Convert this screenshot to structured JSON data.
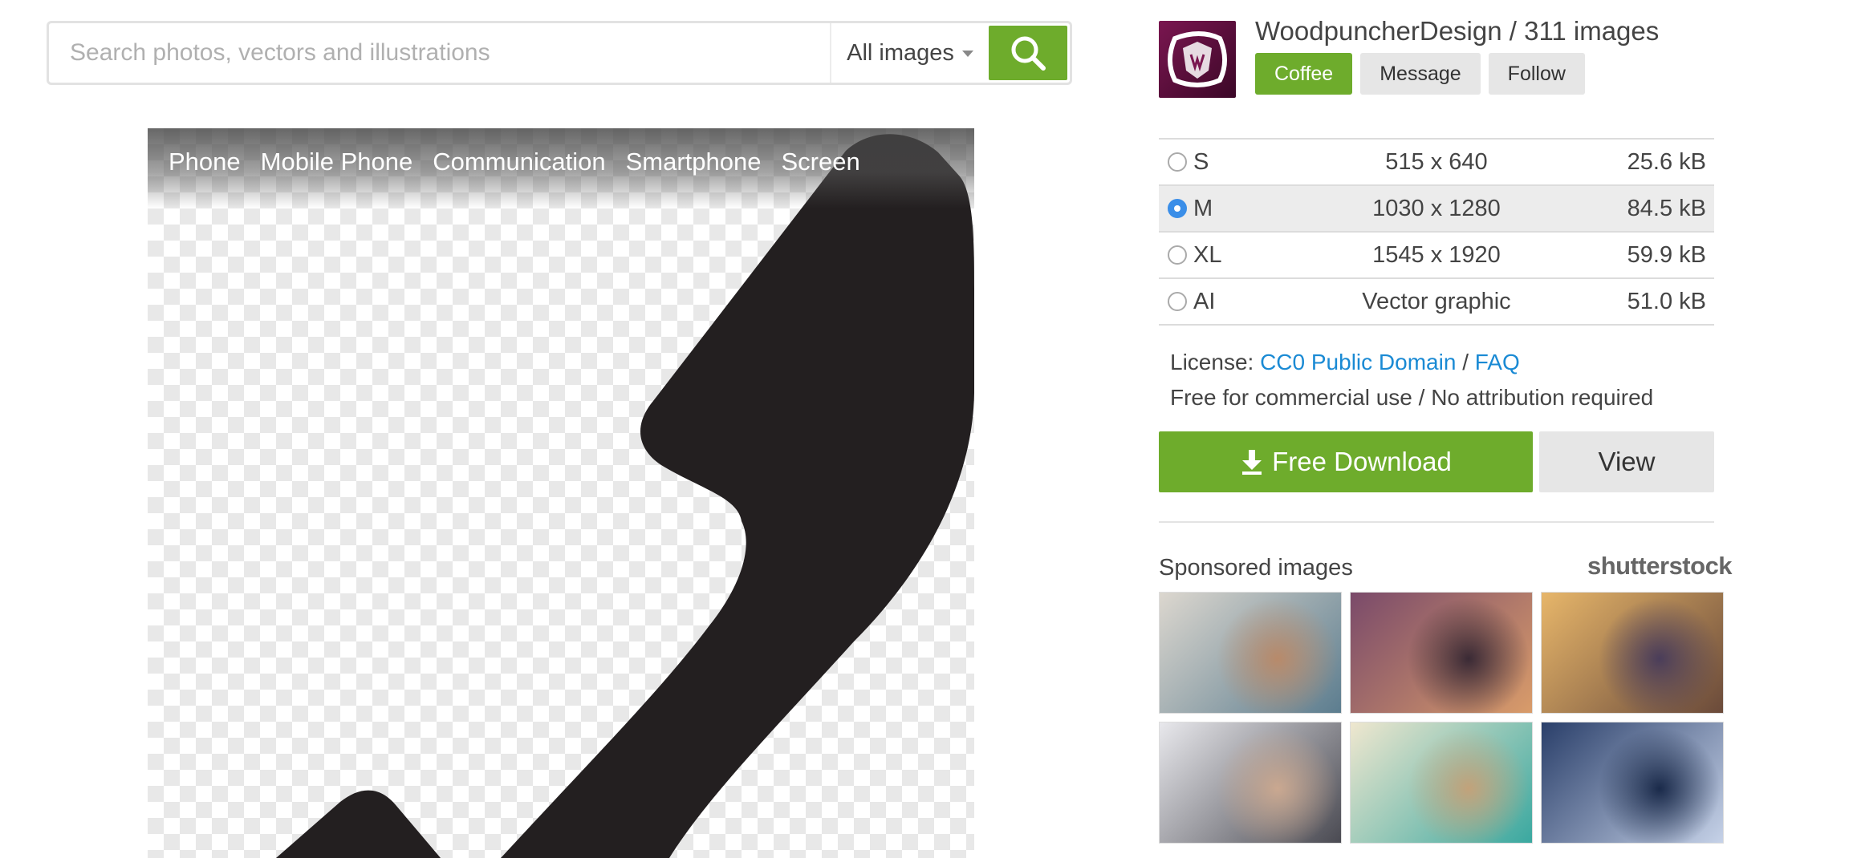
{
  "search": {
    "placeholder": "Search photos, vectors and illustrations",
    "scope_label": "All images",
    "submit_icon": "search-icon"
  },
  "image": {
    "tags": [
      "Phone",
      "Mobile Phone",
      "Communication",
      "Smartphone",
      "Screen"
    ],
    "background": "transparency-checkerboard",
    "subject_color": "#231f20"
  },
  "author": {
    "name_line": "WoodpuncherDesign / 311 images",
    "buttons": {
      "coffee": "Coffee",
      "message": "Message",
      "follow": "Follow"
    }
  },
  "sizes": [
    {
      "code": "S",
      "dims": "515 x 640",
      "file": "25.6 kB",
      "selected": false
    },
    {
      "code": "M",
      "dims": "1030 x 1280",
      "file": "84.5 kB",
      "selected": true
    },
    {
      "code": "XL",
      "dims": "1545 x 1920",
      "file": "59.9 kB",
      "selected": false
    },
    {
      "code": "AI",
      "dims": "Vector graphic",
      "file": "51.0 kB",
      "selected": false
    }
  ],
  "license": {
    "prefix": "License:",
    "name": "CC0 Public Domain",
    "separator": "/",
    "faq": "FAQ",
    "note": "Free for commercial use / No attribution required"
  },
  "actions": {
    "download": "Free Download",
    "download_icon": "download-icon",
    "view": "View"
  },
  "sponsored": {
    "label": "Sponsored images",
    "brand": "shutterstock",
    "thumbs": [
      {
        "name": "man-holding-phone",
        "colors": [
          "#dcd7cf",
          "#5c7d8f",
          "#b88a6a"
        ]
      },
      {
        "name": "phone-bokeh-lights",
        "colors": [
          "#7a4a6a",
          "#d99c6a",
          "#3a2a35"
        ]
      },
      {
        "name": "hand-touching-phone",
        "colors": [
          "#e7b66a",
          "#6a4a3a",
          "#4a3d5a"
        ]
      },
      {
        "name": "dialing-desk-phone",
        "colors": [
          "#e8e8ec",
          "#4a4a52",
          "#caa890"
        ]
      },
      {
        "name": "vintage-green-phone",
        "colors": [
          "#efe7cf",
          "#3aa8a0",
          "#c2a27a"
        ]
      },
      {
        "name": "businessman-with-phone",
        "colors": [
          "#2a3f6a",
          "#c6d2e8",
          "#1a2a4a"
        ]
      }
    ]
  },
  "colors": {
    "accent_green": "#6eac2c",
    "link_blue": "#1a8ad4",
    "radio_blue": "#3a8ee8"
  }
}
